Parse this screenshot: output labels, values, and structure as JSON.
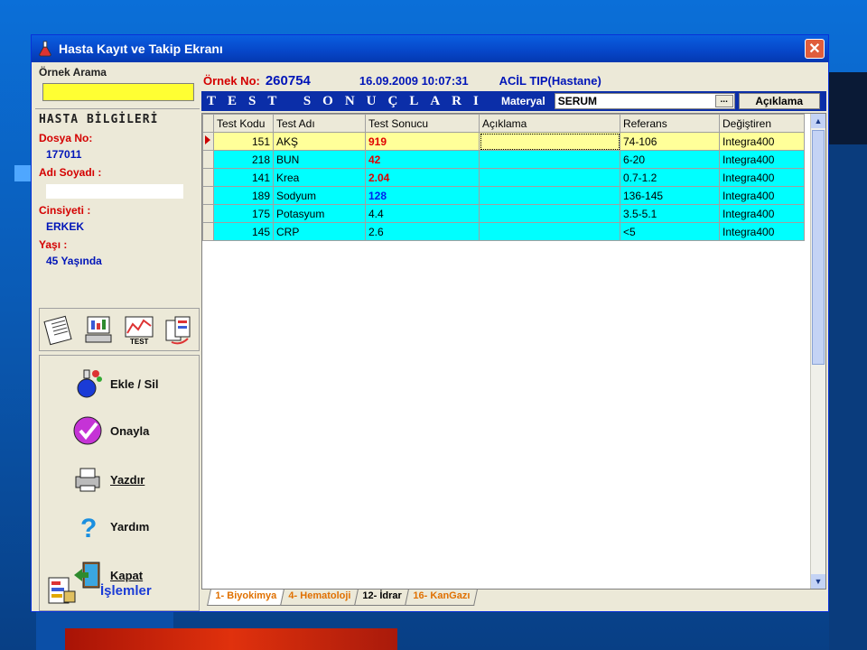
{
  "window": {
    "title": "Hasta Kayıt ve Takip Ekranı",
    "close_label": "✕"
  },
  "sidebar": {
    "search_label": "Örnek Arama",
    "search_value": "",
    "info_title": "HASTA BİLGİLERİ",
    "dosya_label": "Dosya No:",
    "dosya_value": "177011",
    "adi_label": "Adı Soyadı :",
    "cinsiyet_label": "Cinsiyeti :",
    "cinsiyet_value": "ERKEK",
    "yas_label": "Yaşı :",
    "yas_value": "45 Yaşında",
    "actions": [
      {
        "label": "Ekle / Sil"
      },
      {
        "label": "Onayla"
      },
      {
        "label": "Yazdır"
      },
      {
        "label": "Yardım"
      },
      {
        "label": "Kapat"
      }
    ],
    "islemler_label": "İşlemler"
  },
  "header": {
    "ornek_label": "Örnek No:",
    "ornek_value": "260754",
    "datetime": "16.09.2009 10:07:31",
    "department": "ACİL TIP(Hastane)"
  },
  "results_bar": {
    "title": "TEST SONUÇLARI",
    "materyal_label": "Materyal",
    "materyal_value": "SERUM",
    "dots": "...",
    "aciklama_button": "Açıklama"
  },
  "grid": {
    "columns": [
      "Test Kodu",
      "Test Adı",
      "Test Sonucu",
      "Açıklama",
      "Referans",
      "Değiştiren"
    ],
    "rows": [
      {
        "code": "151",
        "name": "AKŞ",
        "result": "919",
        "note": "",
        "ref": "74-106",
        "by": "Integra400"
      },
      {
        "code": "218",
        "name": "BUN",
        "result": "42",
        "note": "",
        "ref": "6-20",
        "by": "Integra400"
      },
      {
        "code": "141",
        "name": "Krea",
        "result": "2.04",
        "note": "",
        "ref": "0.7-1.2",
        "by": "Integra400"
      },
      {
        "code": "189",
        "name": "Sodyum",
        "result": "128",
        "note": "",
        "ref": "136-145",
        "by": "Integra400"
      },
      {
        "code": "175",
        "name": "Potasyum",
        "result": "4.4",
        "note": "",
        "ref": "3.5-5.1",
        "by": "Integra400"
      },
      {
        "code": "145",
        "name": "CRP",
        "result": "2.6",
        "note": "",
        "ref": "<5",
        "by": "Integra400"
      }
    ]
  },
  "tabs": [
    "1- Biyokimya",
    "4- Hematoloji",
    "12- İdrar",
    "16- KanGazı"
  ],
  "colors": {
    "row_highlight": "#00ffff",
    "selected_row": "#ffff99",
    "title_bar": "#0646c8",
    "search_bg": "#ffff33"
  }
}
